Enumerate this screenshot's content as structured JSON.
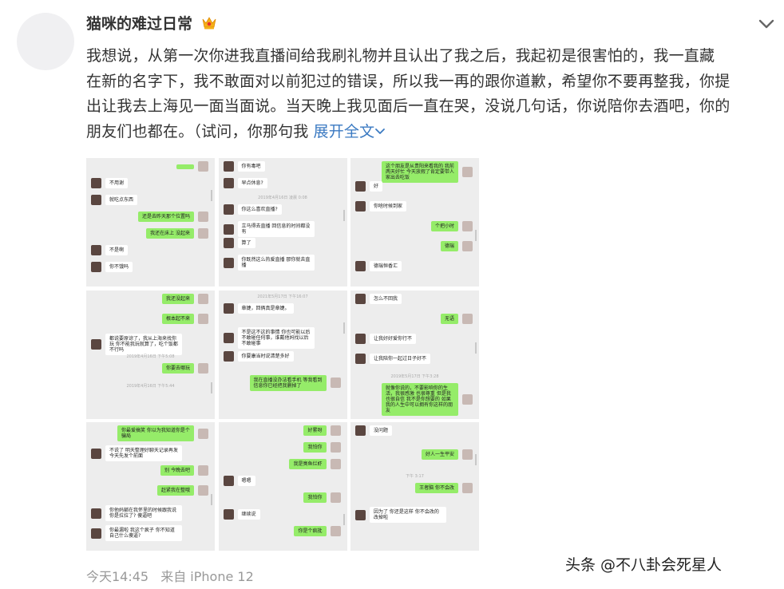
{
  "post": {
    "user_name": "猫咪的难过日常",
    "text_lines": [
      "我想说，从第一次你进我直播间给我刷礼物并且认出了我之后，我起初是很害怕的，我一直藏",
      "在新的名字下，我不敢面对以前犯过的错误，所以我一再的跟你道歉，希望你不要再整我，你提",
      "出让我去上海见一面当面说。当天晚上我见面后一直在哭，没说几句话，你说陪你去酒吧，你的",
      "朋友们也都在。（试问，你那句我"
    ],
    "expand_label": "展开全文",
    "time": "今天14:45",
    "source": "来自 iPhone 12",
    "watermark": "头条 @不八卦会死星人",
    "accent_color": "#3b7ac2",
    "icons": [
      "crown-icon",
      "chevron-down-icon"
    ]
  },
  "grid": [
    [
      {
        "side": "right",
        "text": ""
      },
      {
        "side": "left",
        "text": "不用谢"
      },
      {
        "side": "left",
        "text": "就吃点东西"
      },
      {
        "side": "right",
        "text": "还是去昨天那个位置吗"
      },
      {
        "side": "right",
        "text": "我还在床上 没起来"
      },
      {
        "side": "left",
        "text": "不是啊"
      },
      {
        "side": "left",
        "text": "你不饿吗"
      }
    ],
    [
      {
        "side": "left",
        "text": "你有毒吧"
      },
      {
        "side": "left",
        "text": "早点休息?"
      },
      {
        "ts": "2019年4月16日 凌晨 0:08"
      },
      {
        "side": "left",
        "text": "你这么喜欢直播?"
      },
      {
        "side": "left",
        "text": "立马得去直播 回信息的时间都没有"
      },
      {
        "side": "left",
        "text": "算了"
      },
      {
        "side": "left",
        "text": "你既然这么热爱直播 那你就去直播"
      }
    ],
    [
      {
        "side": "right",
        "text": "这个朋友是从贵阳来看我的 我前两天好忙 今天放假了肯定要带人家出去吃饭"
      },
      {
        "side": "left",
        "text": "好"
      },
      {
        "side": "left",
        "text": "你啥时候到家"
      },
      {
        "side": "right",
        "text": "个把小时"
      },
      {
        "side": "right",
        "text": "德瑞"
      },
      {
        "side": "left",
        "text": "德瑞恒香汇"
      }
    ],
    [
      {
        "side": "right",
        "text": "我还没起来"
      },
      {
        "side": "right",
        "text": "根本起不来"
      },
      {
        "side": "left",
        "text": "都说要原谅了，我从上海来找你玩 你不能我玩就算了，吃个饭都不行吗"
      },
      {
        "ts": "2019年4月16日 下午5:08"
      },
      {
        "side": "right",
        "text": "你要去哪玩"
      },
      {
        "ts": "2019年4月16日 下午5:44"
      }
    ],
    [
      {
        "ts": "2021年5月17日 下午16:07"
      },
      {
        "side": "left",
        "text": "章婕，回俩真是章婕。"
      },
      {
        "side": "left",
        "text": "不是这不这的事情 你也可能以后不敢碰任何事，谁戴他妈找以后不敢碰事"
      },
      {
        "side": "left",
        "text": "你要康当时说清楚多好"
      },
      {
        "side": "right",
        "text": "我在直播没办法看手机 等我看到信息你已经把我删掉了"
      }
    ],
    [
      {
        "side": "left",
        "text": "怎么不回我"
      },
      {
        "side": "right",
        "text": "无语"
      },
      {
        "side": "left",
        "text": "让我好好爱你行不"
      },
      {
        "side": "left",
        "text": "让我陪你一起过日子好不"
      },
      {
        "ts": "2019年5月17日 下午3:28"
      },
      {
        "side": "right",
        "text": "就像你说的，不要影响你的生活，我很感激 也很尊重 但是我也很自信 我不是你想要的 如果我的人生中可以拥有你这样的朋友"
      }
    ],
    [
      {
        "side": "right",
        "text": "你最爱搞笑 你以为我知道你是个骗局"
      },
      {
        "side": "left",
        "text": "不说了 明天整理好聊天记录再发 今天先发个前面"
      },
      {
        "side": "right",
        "text": "别 今晚去吧"
      },
      {
        "side": "right",
        "text": "赶紧我在整哦"
      },
      {
        "side": "left",
        "text": "你他妈躺在我怀里的时候跟我说你是拉拉了? 傻逼吧"
      },
      {
        "side": "left",
        "text": "你最漏啦 我这个疯子 你不知道自己什么傻逼?"
      }
    ],
    [
      {
        "side": "right",
        "text": "好累呀"
      },
      {
        "side": "right",
        "text": "我怕你"
      },
      {
        "side": "right",
        "text": "我是臭鱼烂虾"
      },
      {
        "side": "left",
        "text": "嗯嗯"
      },
      {
        "side": "right",
        "text": "我怕你"
      },
      {
        "side": "left",
        "text": "继续说"
      },
      {
        "side": "right",
        "text": "你是个疯批"
      }
    ],
    [
      {
        "side": "left",
        "text": "没问题"
      },
      {
        "side": "right",
        "text": "好人一生平安"
      },
      {
        "ts": "下午 3:17"
      },
      {
        "side": "right",
        "text": "王者脑 你不会改"
      },
      {
        "side": "left",
        "text": "因为了 你还是这样 你不会改的 改掉啦"
      }
    ]
  ]
}
